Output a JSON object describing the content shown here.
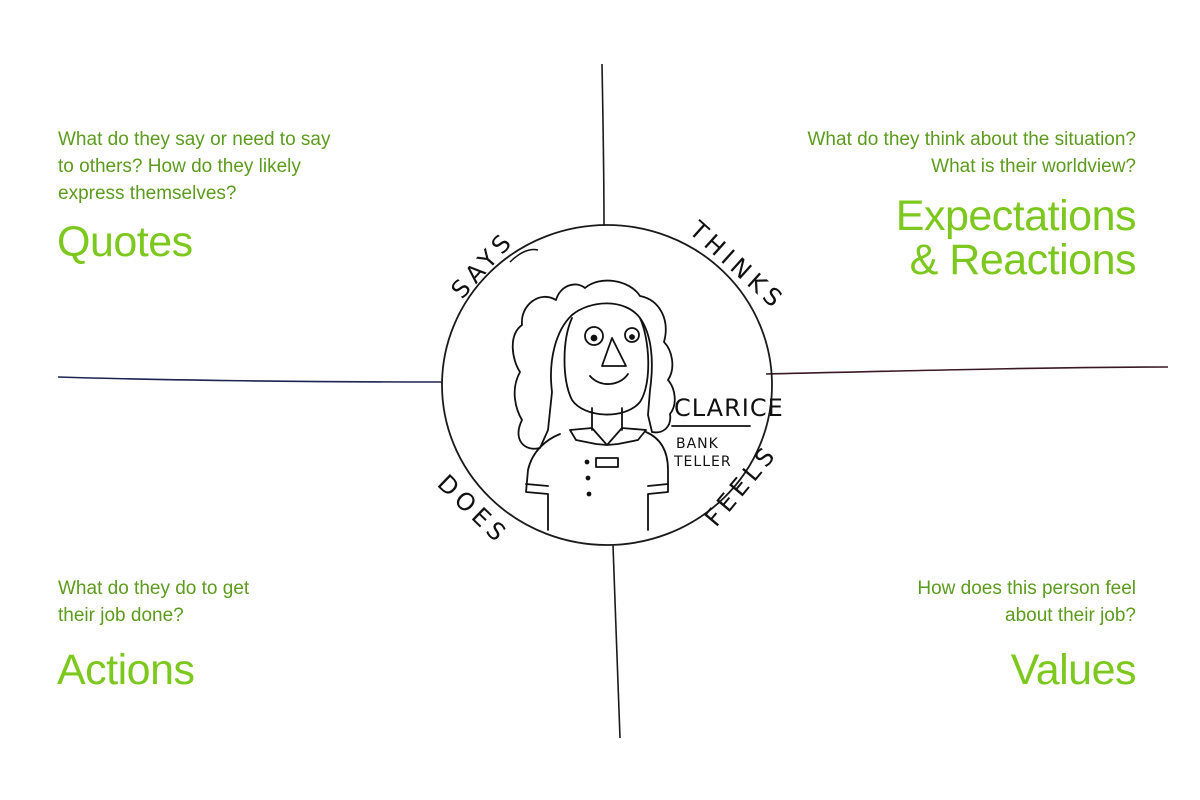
{
  "persona": {
    "name": "CLARICE",
    "role_line1": "BANK",
    "role_line2": "TELLER"
  },
  "circle_labels": {
    "says": "SAYS",
    "thinks": "THINKS",
    "does": "DOES",
    "feels": "FEELS"
  },
  "quadrants": {
    "top_left": {
      "prompt": "What do they say or need to say\nto others?  How do they likely\nexpress themselves?",
      "title": "Quotes"
    },
    "top_right": {
      "prompt": "What do they think about the situation?\nWhat is their worldview?",
      "title": "Expectations\n& Reactions"
    },
    "bottom_left": {
      "prompt": "What do they do to get\ntheir job done?",
      "title": "Actions"
    },
    "bottom_right": {
      "prompt": "How does this person feel\nabout their job?",
      "title": "Values"
    }
  },
  "colors": {
    "prompt": "#5c9b1e",
    "title": "#7dc81e",
    "ink": "#111111"
  }
}
